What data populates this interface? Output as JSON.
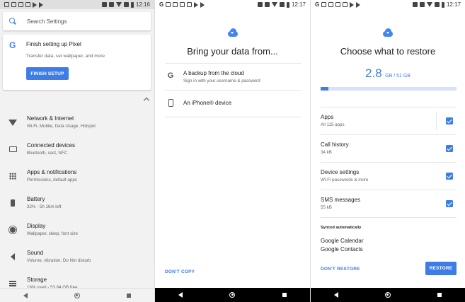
{
  "colors": {
    "accent": "#3f7de6",
    "google_blue": "#4285f4",
    "settings_bg": "#f2f2f2"
  },
  "screen1": {
    "status_time": "12:16",
    "search": {
      "placeholder": "Search Settings",
      "icon": "search-icon"
    },
    "setup_card": {
      "logo": "G",
      "title": "Finish setting up Pixel",
      "subtitle": "Transfer data, set wallpaper, and more",
      "button": "FINISH SETUP"
    },
    "items": [
      {
        "icon": "wifi-icon",
        "title": "Network & Internet",
        "subtitle": "Wi-Fi, Mobile, Data Usage, Hotspot"
      },
      {
        "icon": "devices-icon",
        "title": "Connected devices",
        "subtitle": "Bluetooth, cast, NFC"
      },
      {
        "icon": "apps-grid-icon",
        "title": "Apps & notifications",
        "subtitle": "Permissions, default apps"
      },
      {
        "icon": "battery-icon",
        "title": "Battery",
        "subtitle": "32% - 5h 16m left"
      },
      {
        "icon": "display-icon",
        "title": "Display",
        "subtitle": "Wallpaper, sleep, font size"
      },
      {
        "icon": "sound-icon",
        "title": "Sound",
        "subtitle": "Volume, vibration, Do Not disturb"
      },
      {
        "icon": "storage-icon",
        "title": "Storage",
        "subtitle": "16% used - 53.84 GB free"
      }
    ]
  },
  "screen2": {
    "status_time": "12:17",
    "title": "Bring your data from...",
    "options": [
      {
        "icon": "google-g-icon",
        "label": "A backup from the cloud",
        "sublabel": "Sign in with your username & password"
      },
      {
        "icon": "phone-icon",
        "label": "An iPhone® device",
        "sublabel": ""
      }
    ],
    "dont_copy": "DON'T COPY"
  },
  "screen3": {
    "status_time": "12:17",
    "title": "Choose what to restore",
    "storage_used": "2.8",
    "storage_unit": "GB / 51 GB",
    "storage_fraction": 0.055,
    "items": [
      {
        "title": "Apps",
        "subtitle": "All 115 apps",
        "checked": true
      },
      {
        "title": "Call history",
        "subtitle": "34 kB",
        "checked": true
      },
      {
        "title": "Device settings",
        "subtitle": "Wi-Fi passwords & more",
        "checked": true
      },
      {
        "title": "SMS messages",
        "subtitle": "55 kB",
        "checked": true
      }
    ],
    "synced_label": "Synced automatically",
    "synced_items": [
      "Google Calendar",
      "Google Contacts"
    ],
    "dont_restore": "DON'T RESTORE",
    "restore": "RESTORE"
  }
}
